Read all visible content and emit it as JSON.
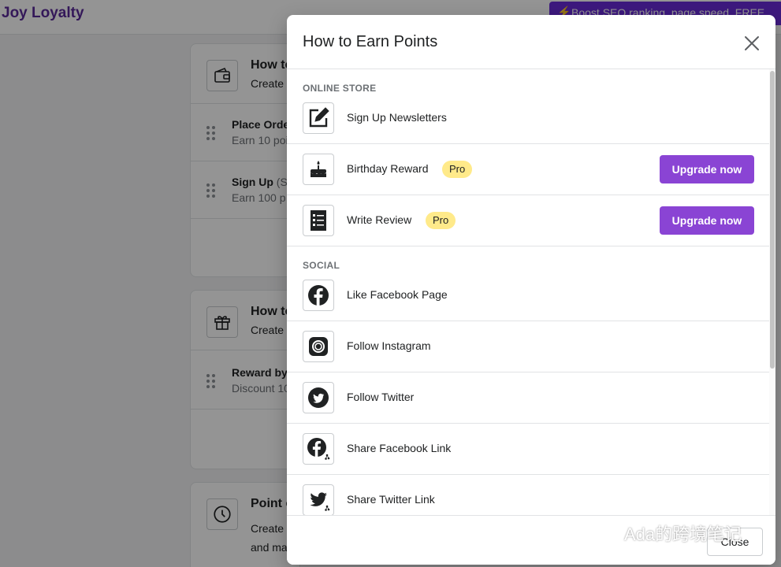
{
  "app": {
    "title": "Joy Loyalty",
    "promo": "Boost SEO ranking, page speed, FREE"
  },
  "background": {
    "cards": [
      {
        "icon": "wallet-icon",
        "title": "How to",
        "subtitle": "Create",
        "rules": [
          {
            "name": "Place Orde",
            "extra": "",
            "desc": "Earn 10 poi"
          },
          {
            "name": "Sign Up",
            "extra": "(S",
            "desc": "Earn 100 p"
          }
        ]
      },
      {
        "icon": "gift-icon",
        "title": "How to",
        "subtitle": "Create",
        "rules": [
          {
            "name": "Reward by",
            "extra": "",
            "desc": "Discount 10"
          }
        ]
      },
      {
        "icon": "clock-icon",
        "title": "Point e",
        "subtitle": "Create",
        "subtitle2": "and ma"
      }
    ]
  },
  "modal": {
    "title": "How to Earn Points",
    "close_label": "Close",
    "sections": [
      {
        "label": "ONLINE STORE",
        "items": [
          {
            "label": "Sign Up Newsletters",
            "icon": "edit-icon"
          },
          {
            "label": "Birthday Reward",
            "icon": "cake-icon",
            "badge": "Pro",
            "action": "Upgrade now"
          },
          {
            "label": "Write Review",
            "icon": "review-list-icon",
            "badge": "Pro",
            "action": "Upgrade now"
          }
        ]
      },
      {
        "label": "SOCIAL",
        "items": [
          {
            "label": "Like Facebook Page",
            "icon": "facebook-icon"
          },
          {
            "label": "Follow Instagram",
            "icon": "instagram-icon"
          },
          {
            "label": "Follow Twitter",
            "icon": "twitter-icon"
          },
          {
            "label": "Share Facebook Link",
            "icon": "facebook-share-icon"
          },
          {
            "label": "Share Twitter Link",
            "icon": "twitter-share-icon"
          }
        ]
      }
    ]
  },
  "watermark": "Ada的跨境笔记",
  "colors": {
    "brand": "#5b2a9a",
    "upgrade_button": "#8a44d4",
    "pro_badge": "#ffea8a",
    "promo_banner": "#6a2bd9"
  }
}
